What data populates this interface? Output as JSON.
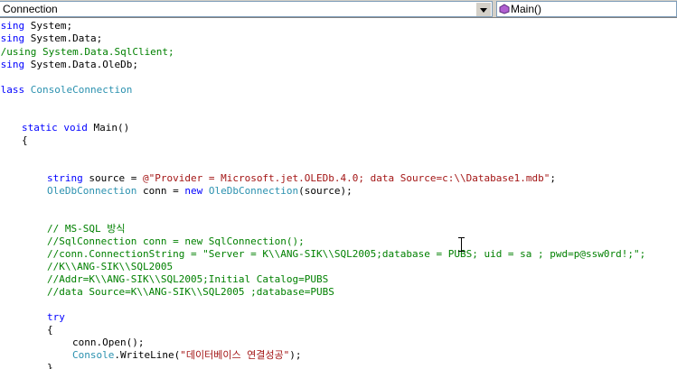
{
  "navbar": {
    "class_combo": "Connection",
    "member_combo": "Main()"
  },
  "code": {
    "l1_kw": "using",
    "l1_rest": " System;",
    "l2_kw": "using",
    "l2_rest": " System.Data;",
    "l3": "//using System.Data.SqlClient;",
    "l4_kw": "using",
    "l4_rest": " System.Data.OleDb;",
    "l5_kw": "class",
    "l5_type": "ConsoleConnection",
    "l6_kw1": "static",
    "l6_kw2": "void",
    "l6_rest": " Main()",
    "l7": "{",
    "l8_kw": "string",
    "l8_a": " source = ",
    "l8_str": "@\"Provider = Microsoft.jet.OLEDb.4.0; data Source=c:\\\\Database1.mdb\"",
    "l8_b": ";",
    "l9_type1": "OleDbConnection",
    "l9_a": " conn = ",
    "l9_kw": "new",
    "l9_type2": "OleDbConnection",
    "l9_b": "(source);",
    "c1": "// MS-SQL 방식",
    "c2": "//SqlConnection conn = new SqlConnection();",
    "c3": "//conn.ConnectionString = \"Server = K\\\\ANG-SIK\\\\SQL2005;database = PUBS; uid = sa ; pwd=p@ssw0rd!;\";",
    "c4": "//K\\\\ANG-SIK\\\\SQL2005",
    "c5": "//Addr=K\\\\ANG-SIK\\\\SQL2005;Initial Catalog=PUBS",
    "c6": "//data Source=K\\\\ANG-SIK\\\\SQL2005 ;database=PUBS",
    "try_kw": "try",
    "brace_open": "{",
    "open_line": "conn.Open();",
    "wl_type": "Console",
    "wl_a": ".WriteLine(",
    "wl_str": "\"데이터베이스 연결성공\"",
    "wl_b": ");",
    "brace_close": "}"
  }
}
